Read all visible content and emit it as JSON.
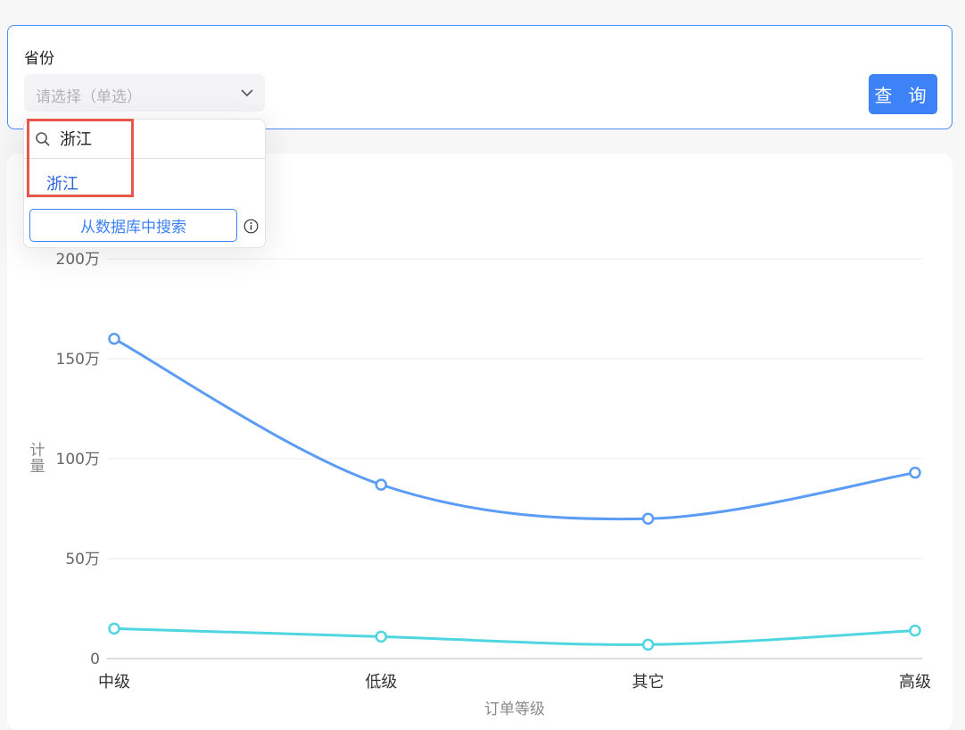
{
  "filter": {
    "label": "省份",
    "select_placeholder": "请选择（单选）",
    "query_button": "查 询"
  },
  "dropdown": {
    "search_value": "浙江",
    "options": [
      "浙江"
    ],
    "db_search_button": "从数据库中搜索"
  },
  "colors": {
    "accent": "#3e82f7",
    "series1": "#5b9cf6",
    "series2": "#4fd6e0",
    "highlight": "#e8574b"
  },
  "chart_data": {
    "type": "line",
    "categories": [
      "中级",
      "低级",
      "其它",
      "高级"
    ],
    "series": [
      {
        "values": [
          1600000,
          870000,
          700000,
          930000
        ]
      },
      {
        "values": [
          150000,
          110000,
          70000,
          140000
        ]
      }
    ],
    "ylabel": "计量",
    "xlabel": "订单等级",
    "ylim": [
      0,
      2000000
    ],
    "yticks": [
      0,
      500000,
      1000000,
      1500000,
      2000000
    ],
    "ytick_labels": [
      "0",
      "50万",
      "100万",
      "150万",
      "200万"
    ],
    "grid": true
  }
}
